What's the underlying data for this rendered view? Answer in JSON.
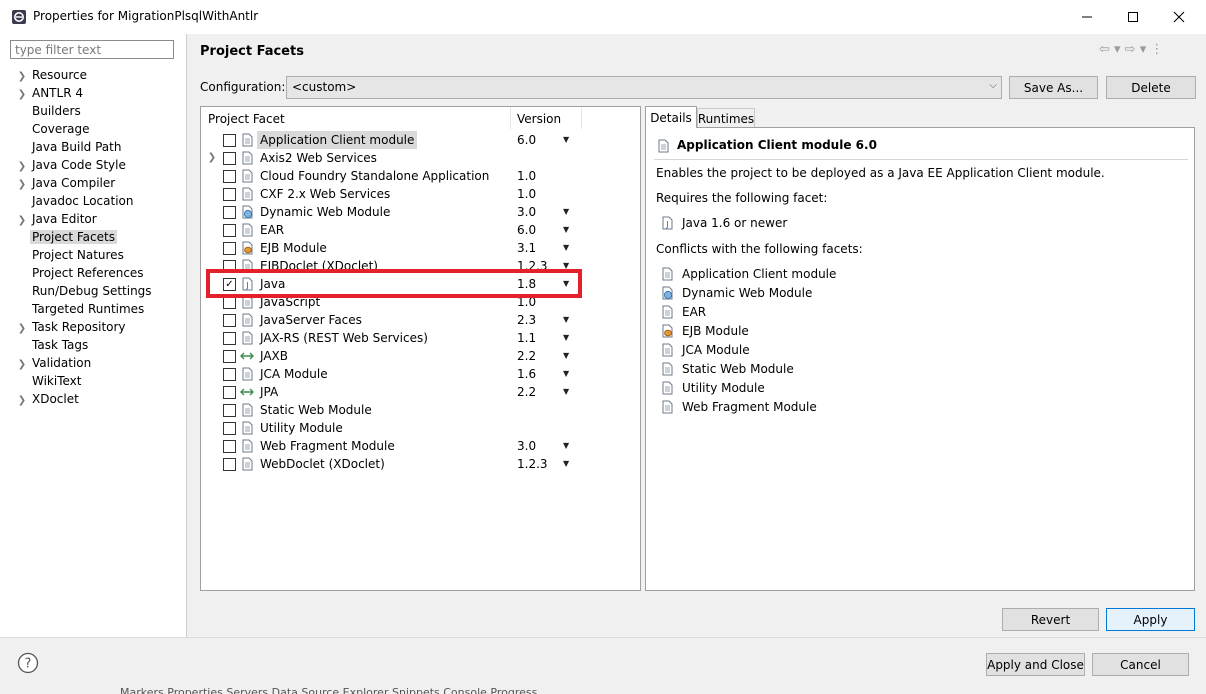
{
  "window": {
    "title": "Properties for MigrationPlsqlWithAntlr",
    "controls": [
      "minimize-icon",
      "maximize-icon",
      "close-icon"
    ]
  },
  "sidebar": {
    "filter_placeholder": "type filter text",
    "items": [
      {
        "label": "Resource",
        "expandable": true
      },
      {
        "label": "ANTLR 4",
        "expandable": true
      },
      {
        "label": "Builders",
        "expandable": false
      },
      {
        "label": "Coverage",
        "expandable": false
      },
      {
        "label": "Java Build Path",
        "expandable": false
      },
      {
        "label": "Java Code Style",
        "expandable": true
      },
      {
        "label": "Java Compiler",
        "expandable": true
      },
      {
        "label": "Javadoc Location",
        "expandable": false
      },
      {
        "label": "Java Editor",
        "expandable": true
      },
      {
        "label": "Project Facets",
        "expandable": false,
        "selected": true
      },
      {
        "label": "Project Natures",
        "expandable": false
      },
      {
        "label": "Project References",
        "expandable": false
      },
      {
        "label": "Run/Debug Settings",
        "expandable": false
      },
      {
        "label": "Targeted Runtimes",
        "expandable": false
      },
      {
        "label": "Task Repository",
        "expandable": true
      },
      {
        "label": "Task Tags",
        "expandable": false
      },
      {
        "label": "Validation",
        "expandable": true
      },
      {
        "label": "WikiText",
        "expandable": false
      },
      {
        "label": "XDoclet",
        "expandable": true
      }
    ]
  },
  "page": {
    "title": "Project Facets",
    "nav_icons": "⇦ ▾ ⇨ ▾ ⋮",
    "configuration_label": "Configuration:",
    "configuration_value": "<custom>",
    "save_as_label": "Save As...",
    "delete_label": "Delete"
  },
  "facets": {
    "col_facet": "Project Facet",
    "col_version": "Version",
    "rows": [
      {
        "name": "Application Client module",
        "version": "6.0",
        "dropdown": true,
        "checked": false,
        "icon": "doc-icon",
        "selected": true
      },
      {
        "name": "Axis2 Web Services",
        "version": "",
        "dropdown": false,
        "checked": false,
        "icon": "doc-icon",
        "expander": true
      },
      {
        "name": "Cloud Foundry Standalone Application",
        "version": "1.0",
        "dropdown": false,
        "checked": false,
        "icon": "doc-icon"
      },
      {
        "name": "CXF 2.x Web Services",
        "version": "1.0",
        "dropdown": false,
        "checked": false,
        "icon": "doc-icon"
      },
      {
        "name": "Dynamic Web Module",
        "version": "3.0",
        "dropdown": true,
        "checked": false,
        "icon": "globe-icon"
      },
      {
        "name": "EAR",
        "version": "6.0",
        "dropdown": true,
        "checked": false,
        "icon": "doc-icon"
      },
      {
        "name": "EJB Module",
        "version": "3.1",
        "dropdown": true,
        "checked": false,
        "icon": "bean-icon"
      },
      {
        "name": "EJBDoclet (XDoclet)",
        "version": "1.2.3",
        "dropdown": true,
        "checked": false,
        "icon": "doc-icon"
      },
      {
        "name": "Java",
        "version": "1.8",
        "dropdown": true,
        "checked": true,
        "icon": "java-icon"
      },
      {
        "name": "JavaScript",
        "version": "1.0",
        "dropdown": false,
        "checked": false,
        "icon": "doc-icon"
      },
      {
        "name": "JavaServer Faces",
        "version": "2.3",
        "dropdown": true,
        "checked": false,
        "icon": "doc-icon"
      },
      {
        "name": "JAX-RS (REST Web Services)",
        "version": "1.1",
        "dropdown": true,
        "checked": false,
        "icon": "doc-icon"
      },
      {
        "name": "JAXB",
        "version": "2.2",
        "dropdown": true,
        "checked": false,
        "icon": "arrows-icon"
      },
      {
        "name": "JCA Module",
        "version": "1.6",
        "dropdown": true,
        "checked": false,
        "icon": "doc-icon"
      },
      {
        "name": "JPA",
        "version": "2.2",
        "dropdown": true,
        "checked": false,
        "icon": "arrows-icon"
      },
      {
        "name": "Static Web Module",
        "version": "",
        "dropdown": false,
        "checked": false,
        "icon": "doc-icon"
      },
      {
        "name": "Utility Module",
        "version": "",
        "dropdown": false,
        "checked": false,
        "icon": "doc-icon"
      },
      {
        "name": "Web Fragment Module",
        "version": "3.0",
        "dropdown": true,
        "checked": false,
        "icon": "doc-icon"
      },
      {
        "name": "WebDoclet (XDoclet)",
        "version": "1.2.3",
        "dropdown": true,
        "checked": false,
        "icon": "doc-icon"
      }
    ]
  },
  "details": {
    "tab_details": "Details",
    "tab_runtimes": "Runtimes",
    "title": "Application Client module 6.0",
    "description": "Enables the project to be deployed as a Java EE Application Client module.",
    "requires_label": "Requires the following facet:",
    "requires": [
      {
        "label": "Java 1.6 or newer",
        "icon": "java-icon"
      }
    ],
    "conflicts_label": "Conflicts with the following facets:",
    "conflicts": [
      {
        "label": "Application Client module",
        "icon": "doc-icon"
      },
      {
        "label": "Dynamic Web Module",
        "icon": "globe-icon"
      },
      {
        "label": "EAR",
        "icon": "doc-icon"
      },
      {
        "label": "EJB Module",
        "icon": "bean-icon"
      },
      {
        "label": "JCA Module",
        "icon": "doc-icon"
      },
      {
        "label": "Static Web Module",
        "icon": "doc-icon"
      },
      {
        "label": "Utility Module",
        "icon": "doc-icon"
      },
      {
        "label": "Web Fragment Module",
        "icon": "doc-icon"
      }
    ]
  },
  "actions": {
    "revert_label": "Revert",
    "apply_label": "Apply",
    "apply_close_label": "Apply and Close",
    "cancel_label": "Cancel"
  },
  "taskbar": {
    "text": "Markers  Properties  Servers  Data Source Explorer  Snippets  Console  Progress"
  },
  "colors": {
    "highlight": "#e4202b",
    "accent": "#0078d7",
    "selection": "#d9d9d9"
  }
}
